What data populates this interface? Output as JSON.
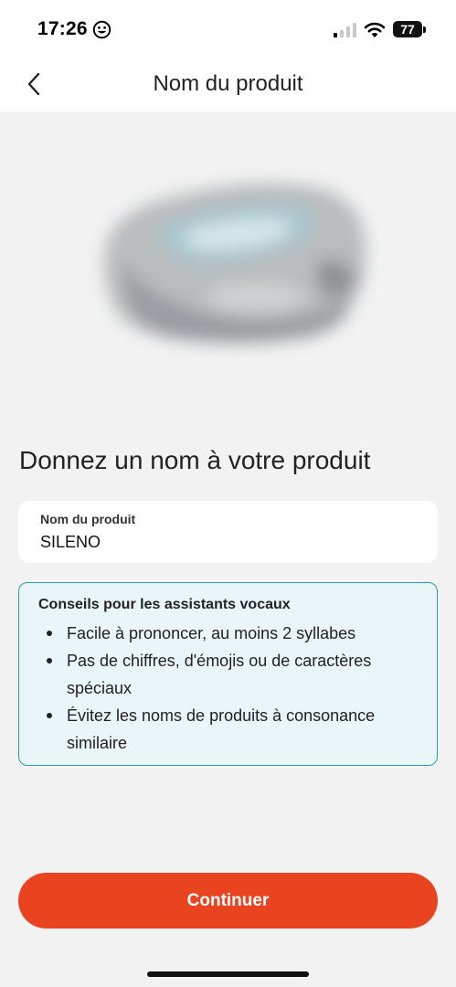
{
  "status_bar": {
    "time": "17:26",
    "battery": "77"
  },
  "nav": {
    "title": "Nom du produit"
  },
  "main": {
    "heading": "Donnez un nom à votre produit",
    "name_field": {
      "label": "Nom du produit",
      "value": "SILENO"
    },
    "tips": {
      "title": "Conseils pour les assistants vocaux",
      "items": [
        "Facile à prononcer, au moins 2 syllabes",
        "Pas de chiffres, d'émojis ou de caractères spéciaux",
        "Évitez les noms de produits à consonance similaire"
      ]
    },
    "continue_label": "Continuer"
  },
  "colors": {
    "accent": "#ea431f",
    "tips_border": "#2a98ac",
    "tips_background": "#eaf5f7"
  }
}
